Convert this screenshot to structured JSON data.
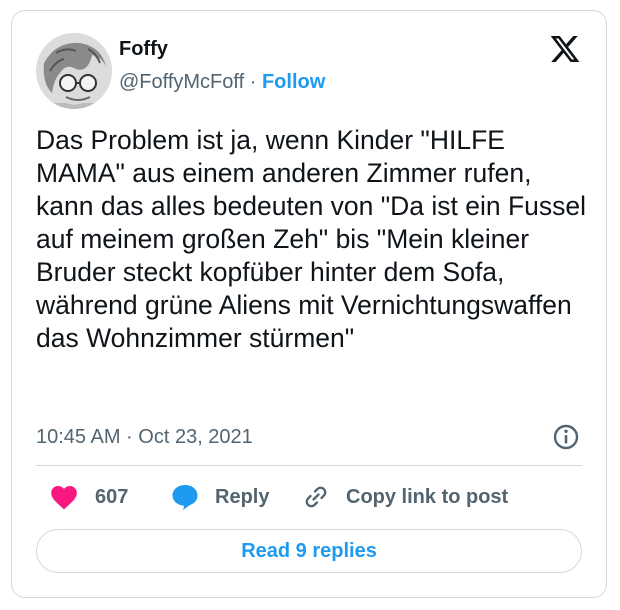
{
  "author": {
    "display_name": "Foffy",
    "handle": "@FoffyMcFoff",
    "separator": "·",
    "follow_label": "Follow",
    "avatar_icon": "avatar-photo"
  },
  "platform_icon": "x-logo",
  "tweet": {
    "text": "Das Problem ist ja, wenn Kinder \"HILFE MAMA\" aus einem anderen Zimmer rufen, kann das alles bedeuten von \"Da ist ein Fussel auf meinem großen Zeh\" bis \"Mein kleiner Bruder steckt kopfüber hinter dem Sofa, während grüne Aliens mit Vernichtungswaffen das Wohnzimmer stürmen\"",
    "timestamp": "10:45 AM · Oct 23, 2021",
    "info_icon": "info-icon"
  },
  "actions": {
    "likes": {
      "icon": "heart-icon",
      "count": "607"
    },
    "reply": {
      "icon": "speech-bubble-icon",
      "label": "Reply"
    },
    "copy_link": {
      "icon": "link-icon",
      "label": "Copy link to post"
    }
  },
  "read_replies_label": "Read 9 replies",
  "colors": {
    "accent": "#1d9bf0",
    "like": "#f91880",
    "muted_text": "#536471",
    "border": "#cfd9de",
    "text": "#0f1419"
  }
}
